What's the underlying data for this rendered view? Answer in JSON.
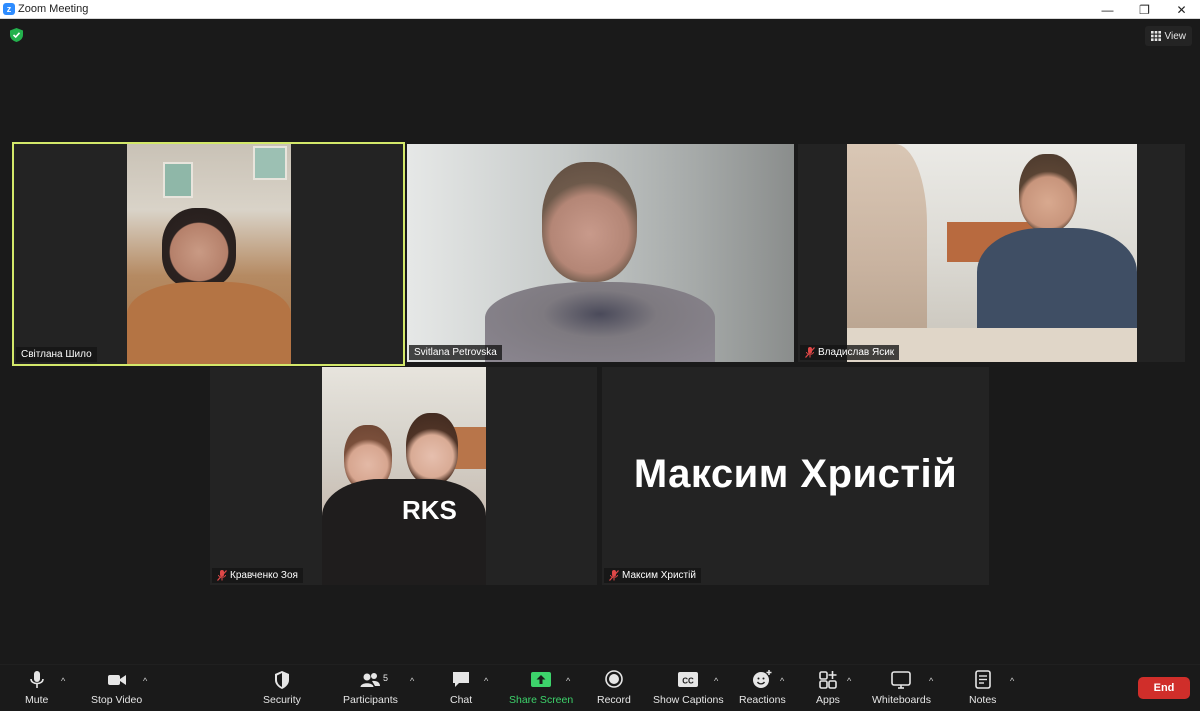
{
  "window": {
    "title": "Zoom Meeting",
    "minimize": "—",
    "maximize": "❐",
    "close": "✕"
  },
  "header": {
    "view_label": "View"
  },
  "participants": [
    {
      "name": "Світлана Шило",
      "muted": false
    },
    {
      "name": "Svitlana Petrovska",
      "muted": false
    },
    {
      "name": "Владислав Ясик",
      "muted": true
    },
    {
      "name": "Кравченко Зоя",
      "muted": true
    },
    {
      "name": "Максим Христій",
      "muted": true,
      "video_off_label": "Максим Христій"
    }
  ],
  "toolbar": {
    "mute": "Mute",
    "stop_video": "Stop Video",
    "security": "Security",
    "participants": "Participants",
    "participants_count": "5",
    "chat": "Chat",
    "share_screen": "Share Screen",
    "record": "Record",
    "show_captions": "Show Captions",
    "captions_icon_text": "CC",
    "reactions": "Reactions",
    "apps": "Apps",
    "whiteboards": "Whiteboards",
    "notes": "Notes",
    "end": "End"
  },
  "colors": {
    "active_speaker": "#d3e86a",
    "end_button": "#d02e2a",
    "share_green": "#3dd36b"
  }
}
